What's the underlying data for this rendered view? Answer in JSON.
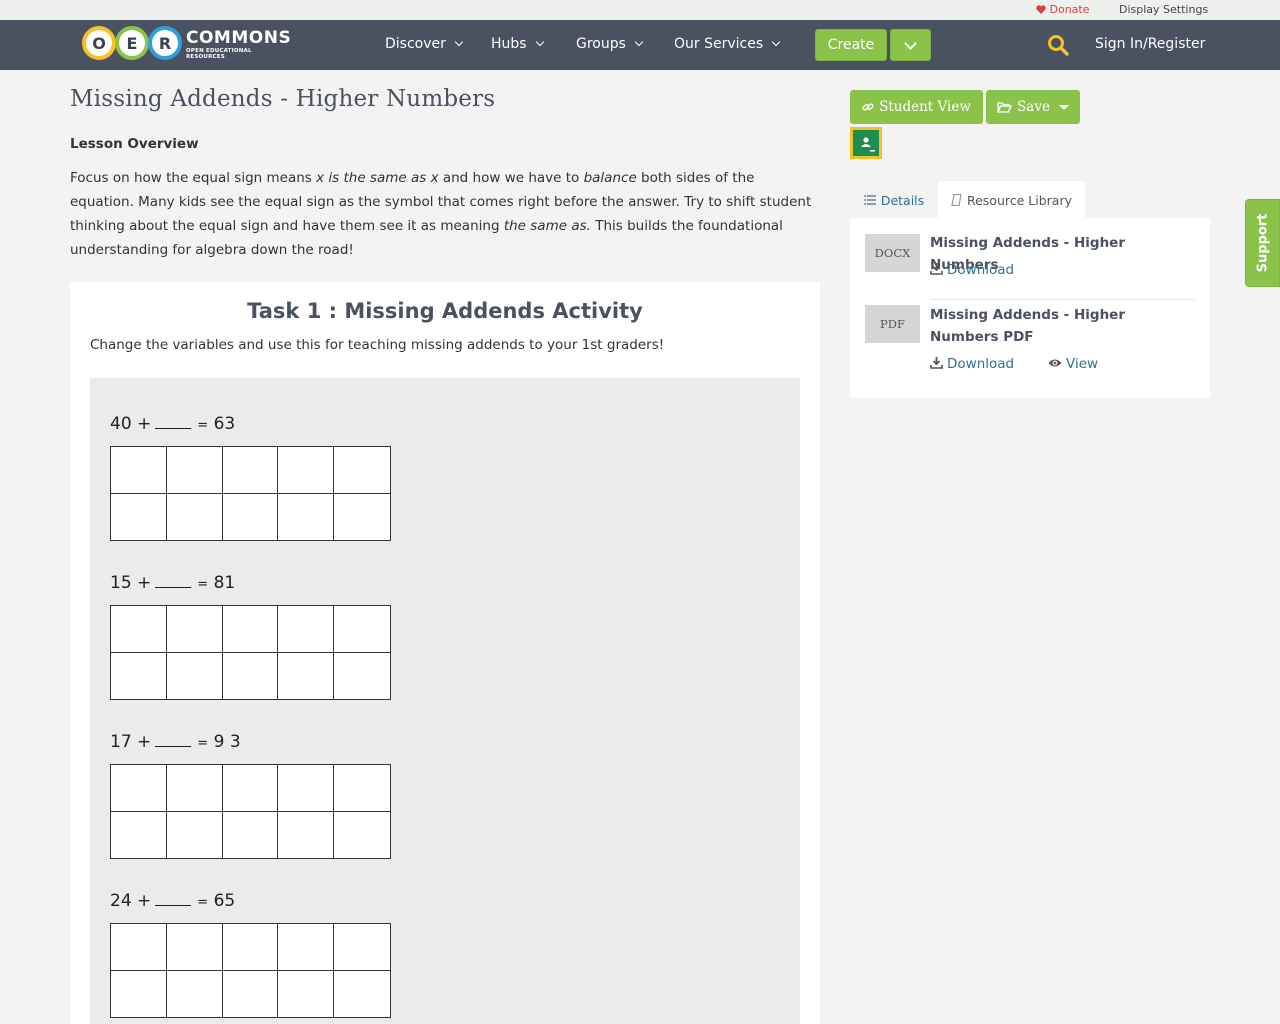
{
  "utility": {
    "donate_label": "Donate",
    "display_settings_label": "Display Settings"
  },
  "brand": {
    "logo_letters": [
      "O",
      "E",
      "R"
    ],
    "logo_colors": [
      "#f6c026",
      "#8bc34a",
      "#2f9fd8"
    ],
    "logo_word": "COMMONS",
    "logo_tagline": "OPEN EDUCATIONAL RESOURCES",
    "accent_green": "#8bc34a",
    "navbar_bg": "#4a5160",
    "link_blue": "#31708f",
    "donate_red": "#d9413f"
  },
  "nav": {
    "items": [
      {
        "label": "Discover"
      },
      {
        "label": "Hubs"
      },
      {
        "label": "Groups"
      },
      {
        "label": "Our Services"
      }
    ],
    "create_label": "Create",
    "signin_label": "Sign In/Register"
  },
  "page": {
    "title": "Missing Addends - Higher Numbers",
    "overview_heading": "Lesson Overview",
    "overview": {
      "p1": "Focus on how the equal sign means ",
      "p1_em": "x is the same as x",
      "p2": " and how we have to ",
      "p2_em": "balance",
      "p3": " both sides of the equation.  Many kids see the equal sign as the symbol that comes right before the answer.  Try to shift student thinking about the equal sign and have them see it as meaning ",
      "p3_em": "the same as.",
      "p4": "  This builds the foundational understanding for algebra down the road!"
    }
  },
  "task": {
    "title": "Task 1 : Missing Addends Activity",
    "description": "Change the variables and use this for teaching missing addends to your 1st graders!",
    "problems": [
      {
        "addend": "40 +",
        "sum": "63"
      },
      {
        "addend": "15 +",
        "sum": "81"
      },
      {
        "addend": "17 +",
        "sum": "9 3"
      },
      {
        "addend": "24 +",
        "sum": "65"
      }
    ],
    "equals_sign": "="
  },
  "sidebar": {
    "student_view_label": "Student View",
    "save_label": "Save",
    "tabs": [
      {
        "label": "Details"
      },
      {
        "label": "Resource Library"
      }
    ],
    "files": [
      {
        "type": "DOCX",
        "name": "Missing Addends - Higher Numbers",
        "download_label": "Download"
      },
      {
        "type": "PDF",
        "name": "Missing Addends - Higher Numbers PDF",
        "download_label": "Download",
        "view_label": "View"
      }
    ],
    "support_label": "Support"
  },
  "icons": {
    "donate": "heart-icon",
    "search": "search-icon",
    "student_view": "link-icon",
    "save": "folder-open-icon",
    "classroom": "google-classroom-icon",
    "details": "list-icon",
    "library": "book-icon",
    "download": "download-icon",
    "view": "eye-icon"
  }
}
